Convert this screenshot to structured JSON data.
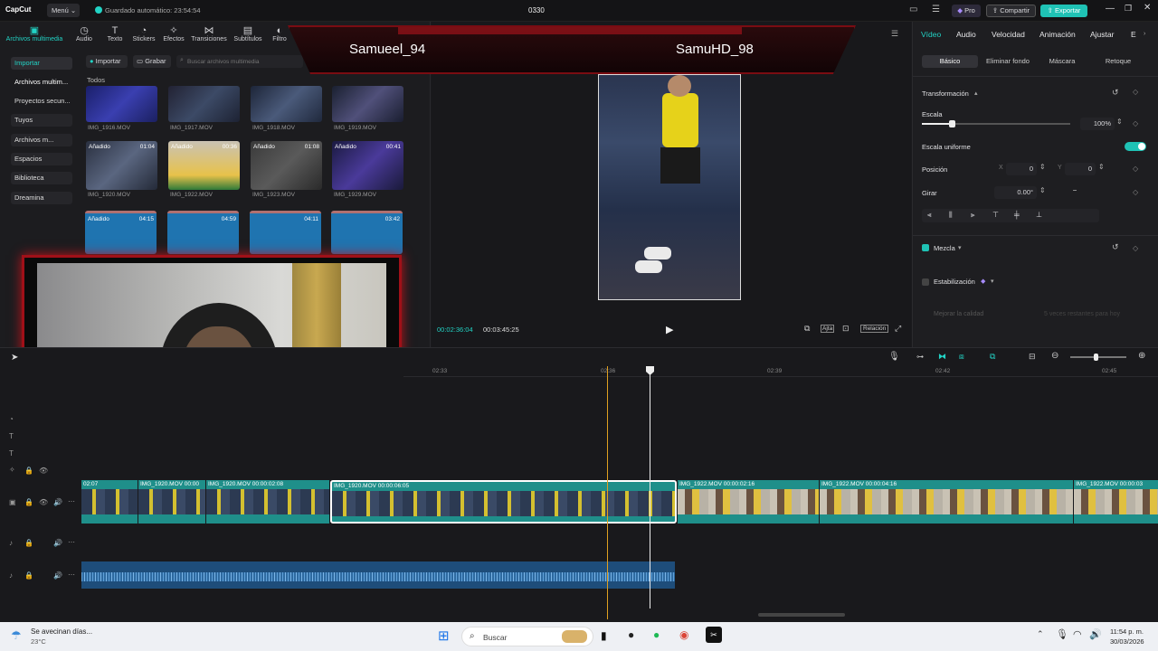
{
  "app": {
    "logo": "CapCut",
    "menu_label": "Menú",
    "autosave": "Guardado automático: 23:54:54",
    "project_name": "0330",
    "pro_label": "Pro",
    "share_label": "Compartir",
    "export_label": "Exportar"
  },
  "toolbar": {
    "items": [
      "Archivos multimedia",
      "Audio",
      "Texto",
      "Stickers",
      "Efectos",
      "Transiciones",
      "Subtítulos",
      "Filtro"
    ]
  },
  "media": {
    "import_label": "Importar",
    "record_label": "Grabar",
    "search_placeholder": "Buscar archivos multimedia",
    "all_label": "Todos",
    "sidebar": [
      "Importar",
      "Archivos multim...",
      "Proyectos secun...",
      "Tuyos",
      "Archivos m...",
      "Espacios",
      "Biblioteca",
      "Dreamina"
    ],
    "row1": [
      "IMG_1916.MOV",
      "IMG_1917.MOV",
      "IMG_1918.MOV",
      "IMG_1919.MOV"
    ],
    "row2": [
      {
        "name": "IMG_1920.MOV",
        "badge": "Añadido",
        "duration": "01:04"
      },
      {
        "name": "IMG_1922.MOV",
        "badge": "Añadido",
        "duration": "00:36"
      },
      {
        "name": "IMG_1923.MOV",
        "badge": "Añadido",
        "duration": "01:08"
      },
      {
        "name": "IMG_1929.MOV",
        "badge": "Añadido",
        "duration": "00:41"
      }
    ],
    "row3": [
      {
        "badge": "Añadido",
        "duration": "04:15"
      },
      {
        "badge": "",
        "duration": "04:59"
      },
      {
        "badge": "",
        "duration": "04:11"
      },
      {
        "badge": "",
        "duration": "03:42"
      }
    ]
  },
  "overlay": {
    "player1": "Samueel_94",
    "player2": "SamuHD_98"
  },
  "preview": {
    "current_time": "00:02:36:04",
    "total_time": "00:03:45:25",
    "ratio_label": "Relación",
    "fit_label": "Ajta"
  },
  "inspector": {
    "tabs": [
      "Vídeo",
      "Audio",
      "Velocidad",
      "Animación",
      "Ajustar",
      "E"
    ],
    "subtabs": [
      "Básico",
      "Eliminar fondo",
      "Máscara",
      "Retoque"
    ],
    "transform_label": "Transformación",
    "scale_label": "Escala",
    "scale_value": "100%",
    "scale_level": 0.2,
    "uniform_label": "Escala uniforme",
    "position_label": "Posición",
    "pos_x_label": "X",
    "pos_x": "0",
    "pos_y_label": "Y",
    "pos_y": "0",
    "rotate_label": "Girar",
    "rotate_value": "0.00°",
    "rotate_sign": "−",
    "blend_label": "Mezcla",
    "stabilize_label": "Estabilización",
    "quality_label": "Mejorar la calidad",
    "quality_hint": "5 veces restantes para hoy"
  },
  "timeline": {
    "ticks": [
      "02:33",
      "02:36",
      "02:39",
      "02:42",
      "02:45"
    ],
    "clips": [
      {
        "label": "02:07"
      },
      {
        "label": "IMG_1920.MOV  00:00"
      },
      {
        "label": "IMG_1920.MOV  00:00:02:08"
      },
      {
        "label": "IMG_1920.MOV  00:00:06:05"
      },
      {
        "label": "IMG_1922.MOV  00:00:02:16"
      },
      {
        "label": "IMG_1922.MOV  00:00:04:16"
      },
      {
        "label": "IMG_1922.MOV  00:00:03"
      }
    ]
  },
  "taskbar": {
    "weather_text": "Se avecinan días...",
    "temperature": "23°C",
    "search_placeholder": "Buscar",
    "time": "11:54 p. m.",
    "date": "30/03/2026"
  },
  "colors": {
    "accent": "#22d3c5",
    "selection": "#ffffff",
    "clip": "#1f8f8a",
    "audio": "#1e4d7a",
    "overlay_red": "#c0141c"
  }
}
